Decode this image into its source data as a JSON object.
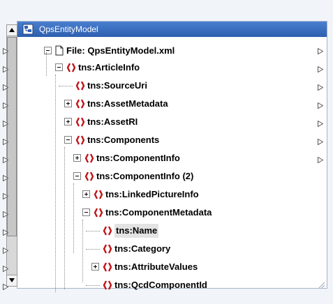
{
  "window": {
    "title": "QpsEntityModel"
  },
  "tree": {
    "file_label": "File: QpsEntityModel.xml",
    "nodes": [
      {
        "label": "tns:ArticleInfo",
        "expander": "minus"
      },
      {
        "label": "tns:SourceUri",
        "expander": "none"
      },
      {
        "label": "tns:AssetMetadata",
        "expander": "plus"
      },
      {
        "label": "tns:AssetRI",
        "expander": "plus"
      },
      {
        "label": "tns:Components",
        "expander": "minus"
      },
      {
        "label": "tns:ComponentInfo",
        "expander": "plus"
      },
      {
        "label": "tns:ComponentInfo (2)",
        "expander": "minus"
      },
      {
        "label": "tns:LinkedPictureInfo",
        "expander": "plus"
      },
      {
        "label": "tns:ComponentMetadata",
        "expander": "minus"
      },
      {
        "label": "tns:Name",
        "expander": "none",
        "selected": true
      },
      {
        "label": "tns:Category",
        "expander": "none"
      },
      {
        "label": "tns:AttributeValues",
        "expander": "plus"
      },
      {
        "label": "tns:QcdComponentId",
        "expander": "none"
      }
    ]
  },
  "colors": {
    "titlebar": "#3a6cc0",
    "element_icon": "#c0141a",
    "selection": "#e3e3e3"
  },
  "icons": {
    "window": "xml-schema-icon",
    "file": "document-icon",
    "element": "element-brackets-icon",
    "port": "connector-triangle-icon"
  }
}
